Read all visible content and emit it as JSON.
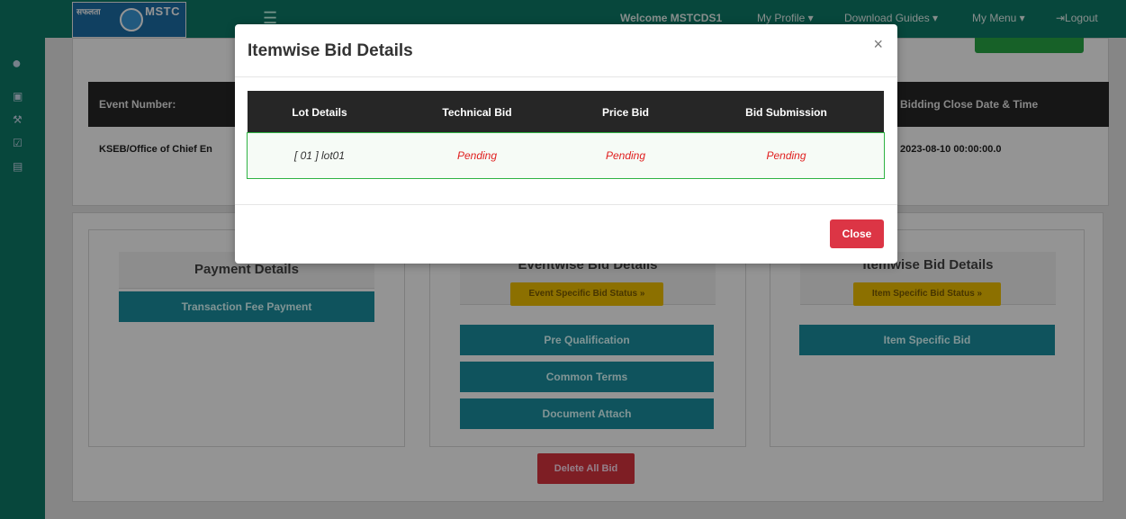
{
  "header": {
    "logo_left_text": "सफलता",
    "logo_right_text": "MSTC",
    "welcome": "Welcome MSTCDS1",
    "my_profile": "My Profile ▾",
    "download_guides": "Download Guides ▾",
    "my_menu": "My Menu ▾",
    "logout": "⇥Logout"
  },
  "background_table": {
    "col_event_number": "Event Number:",
    "col_bidding_close": "Bidding Close Date & Time",
    "row_event": "KSEB/Office of Chief En",
    "row_close_date": "2023-08-10 00:00:00.0"
  },
  "panels": {
    "payment": {
      "title": "Payment Details",
      "button": "Transaction Fee Payment"
    },
    "eventwise": {
      "title": "Eventwise Bid Details",
      "badge": "Event Specific Bid Status »",
      "buttons": [
        "Pre Qualification",
        "Common Terms",
        "Document Attach"
      ]
    },
    "itemwise": {
      "title": "Itemwise Bid Details",
      "badge": "Item Specific Bid Status »",
      "button": "Item Specific Bid"
    },
    "delete_all": "Delete All Bid"
  },
  "modal": {
    "title": "Itemwise Bid Details",
    "close_x": "×",
    "columns": [
      "Lot Details",
      "Technical Bid",
      "Price Bid",
      "Bid Submission"
    ],
    "rows": [
      {
        "lot": "[ 01 ] lot01",
        "technical": "Pending",
        "price": "Pending",
        "submission": "Pending"
      }
    ],
    "close_button": "Close"
  },
  "colors": {
    "topbar": "#0d7a68",
    "pending": "#e02020",
    "close": "#dc3545",
    "teal_button": "#1a8fa1",
    "yellow_badge": "#f2c200"
  }
}
